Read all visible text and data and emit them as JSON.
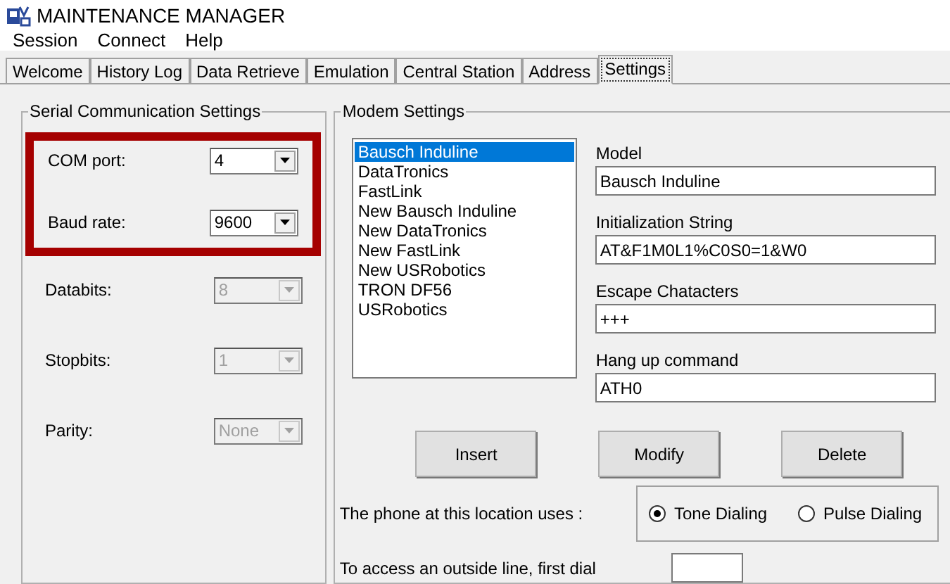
{
  "window": {
    "title": "MAINTENANCE MANAGER"
  },
  "menu": [
    "Session",
    "Connect",
    "Help"
  ],
  "tabs": [
    {
      "label": "Welcome",
      "selected": false
    },
    {
      "label": "History Log",
      "selected": false
    },
    {
      "label": "Data Retrieve",
      "selected": false
    },
    {
      "label": "Emulation",
      "selected": false
    },
    {
      "label": "Central Station",
      "selected": false
    },
    {
      "label": "Address",
      "selected": false
    },
    {
      "label": "Settings",
      "selected": true
    }
  ],
  "serial": {
    "title": "Serial Communication Settings",
    "fields": [
      {
        "label": "COM port:",
        "value": "4",
        "disabled": false,
        "highlighted": true
      },
      {
        "label": "Baud rate:",
        "value": "9600",
        "disabled": false,
        "highlighted": true
      },
      {
        "label": "Databits:",
        "value": "8",
        "disabled": true,
        "highlighted": false
      },
      {
        "label": "Stopbits:",
        "value": "1",
        "disabled": true,
        "highlighted": false
      },
      {
        "label": "Parity:",
        "value": "None",
        "disabled": true,
        "highlighted": false
      }
    ]
  },
  "modem": {
    "title": "Modem Settings",
    "models": [
      {
        "label": "Bausch Induline",
        "selected": true
      },
      {
        "label": "DataTronics",
        "selected": false
      },
      {
        "label": "FastLink",
        "selected": false
      },
      {
        "label": "New Bausch Induline",
        "selected": false
      },
      {
        "label": "New DataTronics",
        "selected": false
      },
      {
        "label": "New FastLink",
        "selected": false
      },
      {
        "label": "New USRobotics",
        "selected": false
      },
      {
        "label": "TRON DF56",
        "selected": false
      },
      {
        "label": "USRobotics",
        "selected": false
      }
    ],
    "fields": [
      {
        "label": "Model",
        "value": "Bausch Induline"
      },
      {
        "label": "Initialization String",
        "value": "AT&F1M0L1%C0S0=1&W0"
      },
      {
        "label": "Escape Chatacters",
        "value": "+++"
      },
      {
        "label": "Hang up command",
        "value": "ATH0"
      }
    ],
    "buttons": [
      "Insert",
      "Modify",
      "Delete"
    ],
    "phone_label": "The phone at this location uses :",
    "dialing": [
      {
        "label": "Tone Dialing",
        "selected": true
      },
      {
        "label": "Pulse Dialing",
        "selected": false
      }
    ],
    "outside_label": "To access an outside line, first dial"
  }
}
